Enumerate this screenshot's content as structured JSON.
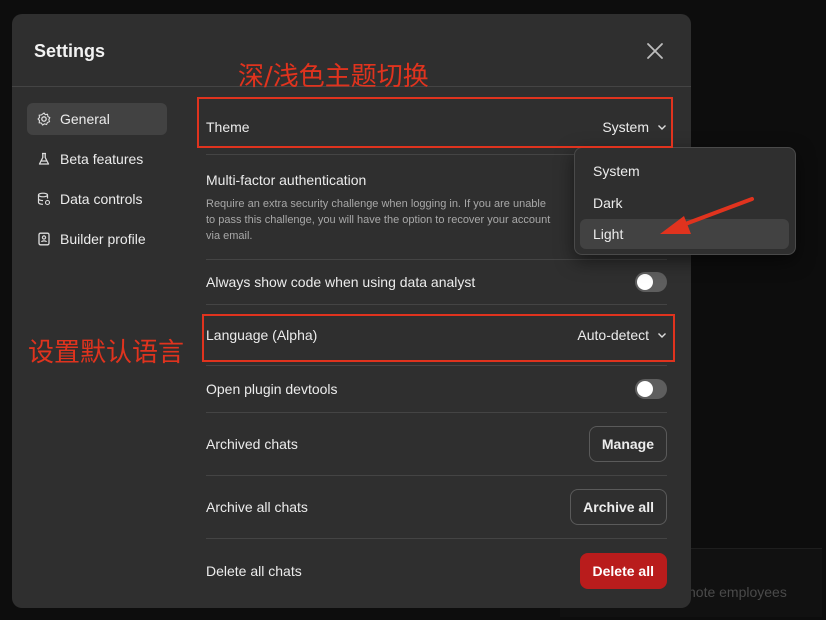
{
  "modal": {
    "title": "Settings"
  },
  "sidebar": {
    "items": [
      {
        "label": "General",
        "icon": "gear-icon",
        "active": true
      },
      {
        "label": "Beta features",
        "icon": "flask-icon",
        "active": false
      },
      {
        "label": "Data controls",
        "icon": "database-icon",
        "active": false
      },
      {
        "label": "Builder profile",
        "icon": "id-card-icon",
        "active": false
      }
    ]
  },
  "settings": {
    "theme": {
      "label": "Theme",
      "value": "System"
    },
    "mfa": {
      "label": "Multi-factor authentication",
      "description": "Require an extra security challenge when logging in. If you are unable to pass this challenge, you will have the option to recover your account via email."
    },
    "code": {
      "label": "Always show code when using data analyst",
      "enabled": false
    },
    "language": {
      "label": "Language (Alpha)",
      "value": "Auto-detect"
    },
    "devtools": {
      "label": "Open plugin devtools",
      "enabled": false
    },
    "archived": {
      "label": "Archived chats",
      "button": "Manage"
    },
    "archive_all": {
      "label": "Archive all chats",
      "button": "Archive all"
    },
    "delete_all": {
      "label": "Delete all chats",
      "button": "Delete all"
    }
  },
  "theme_menu": {
    "options": [
      "System",
      "Dark",
      "Light"
    ],
    "highlighted": "Light"
  },
  "annotations": {
    "theme_note": "深/浅色主题切换",
    "language_note": "设置默认语言",
    "color": "#e0331e"
  },
  "backdrop": {
    "text": "note employees"
  },
  "colors": {
    "modal_bg": "#2f2f2f",
    "danger": "#b91c1c",
    "divider": "#444444"
  }
}
